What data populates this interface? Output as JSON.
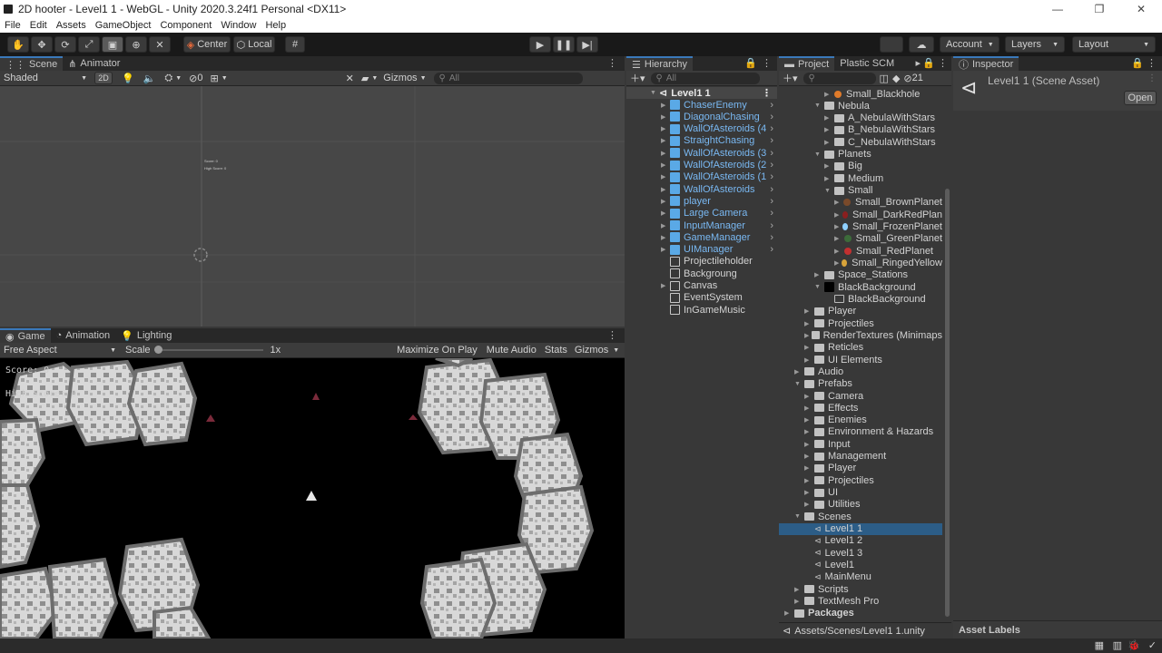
{
  "window": {
    "title": "2D hooter - Level1 1 - WebGL - Unity 2020.3.24f1 Personal <DX11>",
    "minimize": "—",
    "maximize": "❐",
    "close": "✕"
  },
  "menu": [
    "File",
    "Edit",
    "Assets",
    "GameObject",
    "Component",
    "Window",
    "Help"
  ],
  "toolbar": {
    "pivot": "Center",
    "space": "Local",
    "account": "Account",
    "layers": "Layers",
    "layout": "Layout"
  },
  "scene": {
    "tabs": [
      "Scene",
      "Animator"
    ],
    "shading": "Shaded",
    "mode_2d": "2D",
    "hidden_count": "0",
    "gizmos": "Gizmos",
    "search_placeholder": "All",
    "vp_text1": "Score: 0",
    "vp_text2": "High Score: 0"
  },
  "game": {
    "tabs": [
      "Game",
      "Animation",
      "Lighting"
    ],
    "aspect": "Free Aspect",
    "scale_label": "Scale",
    "scale_value": "1x",
    "maximize": "Maximize On Play",
    "mute": "Mute Audio",
    "stats": "Stats",
    "gizmos": "Gizmos",
    "score": "Score: 0",
    "highscore": "High Score: 0"
  },
  "hierarchy": {
    "tab": "Hierarchy",
    "search_placeholder": "All",
    "root": "Level1 1",
    "items": [
      {
        "label": "ChaserEnemy",
        "prefab": true
      },
      {
        "label": "DiagonalChasing",
        "prefab": true
      },
      {
        "label": "WallOfAsteroids (4",
        "prefab": true
      },
      {
        "label": "StraightChasing",
        "prefab": true
      },
      {
        "label": "WallOfAsteroids (3",
        "prefab": true
      },
      {
        "label": "WallOfAsteroids (2",
        "prefab": true
      },
      {
        "label": "WallOfAsteroids (1",
        "prefab": true
      },
      {
        "label": "WallOfAsteroids",
        "prefab": true
      },
      {
        "label": "player",
        "prefab": true
      },
      {
        "label": "Large Camera",
        "prefab": true
      },
      {
        "label": "InputManager",
        "prefab": true
      },
      {
        "label": "GameManager",
        "prefab": true
      },
      {
        "label": "UIManager",
        "prefab": true
      },
      {
        "label": "Projectileholder",
        "prefab": false
      },
      {
        "label": "Backgroung",
        "prefab": false
      },
      {
        "label": "Canvas",
        "prefab": false
      },
      {
        "label": "EventSystem",
        "prefab": false
      },
      {
        "label": "InGameMusic",
        "prefab": false
      }
    ]
  },
  "project": {
    "tabs": [
      "Project",
      "Plastic SCM"
    ],
    "hidden_count": "21",
    "path": "Assets/Scenes/Level1 1.unity",
    "rows": [
      {
        "label": "Small_Blackhole",
        "type": "planet",
        "color": "#e07b2a"
      },
      {
        "label": "Nebula",
        "type": "folder",
        "open": true
      },
      {
        "label": "A_NebulaWithStars",
        "type": "folder",
        "open": false
      },
      {
        "label": "B_NebulaWithStars",
        "type": "folder",
        "open": false
      },
      {
        "label": "C_NebulaWithStars",
        "type": "folder",
        "open": false
      },
      {
        "label": "Planets",
        "type": "folder",
        "open": true
      },
      {
        "label": "Big",
        "type": "folder",
        "open": false
      },
      {
        "label": "Medium",
        "type": "folder",
        "open": false
      },
      {
        "label": "Small",
        "type": "folder",
        "open": true
      },
      {
        "label": "Small_BrownPlanet",
        "type": "planet",
        "color": "#7a4a2a"
      },
      {
        "label": "Small_DarkRedPlan",
        "type": "planet",
        "color": "#8a1f1f"
      },
      {
        "label": "Small_FrozenPlanet",
        "type": "planet",
        "color": "#8fd0ff"
      },
      {
        "label": "Small_GreenPlanet",
        "type": "planet",
        "color": "#3c6b3a"
      },
      {
        "label": "Small_RedPlanet",
        "type": "planet",
        "color": "#c23030"
      },
      {
        "label": "Small_RingedYellow",
        "type": "planet",
        "color": "#d8a43a"
      },
      {
        "label": "Space_Stations",
        "type": "folder",
        "open": false
      },
      {
        "label": "BlackBackground",
        "type": "black",
        "open": true
      },
      {
        "label": "BlackBackground",
        "type": "sprite"
      },
      {
        "label": "Player",
        "type": "folder",
        "open": false
      },
      {
        "label": "Projectiles",
        "type": "folder",
        "open": false
      },
      {
        "label": "RenderTextures (Minimaps",
        "type": "folder",
        "open": false
      },
      {
        "label": "Reticles",
        "type": "folder",
        "open": false
      },
      {
        "label": "UI Elements",
        "type": "folder",
        "open": false
      },
      {
        "label": "Audio",
        "type": "folder",
        "open": false
      },
      {
        "label": "Prefabs",
        "type": "folder",
        "open": true
      },
      {
        "label": "Camera",
        "type": "folder",
        "open": false
      },
      {
        "label": "Effects",
        "type": "folder",
        "open": false
      },
      {
        "label": "Enemies",
        "type": "folder",
        "open": false
      },
      {
        "label": "Environment & Hazards",
        "type": "folder",
        "open": false
      },
      {
        "label": "Input",
        "type": "folder",
        "open": false
      },
      {
        "label": "Management",
        "type": "folder",
        "open": false
      },
      {
        "label": "Player",
        "type": "folder",
        "open": false
      },
      {
        "label": "Projectiles",
        "type": "folder",
        "open": false
      },
      {
        "label": "UI",
        "type": "folder",
        "open": false
      },
      {
        "label": "Utilities",
        "type": "folder",
        "open": false
      },
      {
        "label": "Scenes",
        "type": "folder",
        "open": true
      },
      {
        "label": "Level1 1",
        "type": "scene",
        "selected": true
      },
      {
        "label": "Level1 2",
        "type": "scene"
      },
      {
        "label": "Level1 3",
        "type": "scene"
      },
      {
        "label": "Level1",
        "type": "scene"
      },
      {
        "label": "MainMenu",
        "type": "scene"
      },
      {
        "label": "Scripts",
        "type": "folder",
        "open": false
      },
      {
        "label": "TextMesh Pro",
        "type": "folder",
        "open": false
      },
      {
        "label": "Packages",
        "type": "folder",
        "open": false,
        "bold": true
      }
    ]
  },
  "inspector": {
    "tab": "Inspector",
    "asset_title": "Level1 1 (Scene Asset)",
    "open_button": "Open",
    "asset_labels": "Asset Labels"
  },
  "colors": {
    "selection": "#2c5d87",
    "prefab_text": "#79b8f2",
    "tab_accent": "#3a79bb"
  }
}
